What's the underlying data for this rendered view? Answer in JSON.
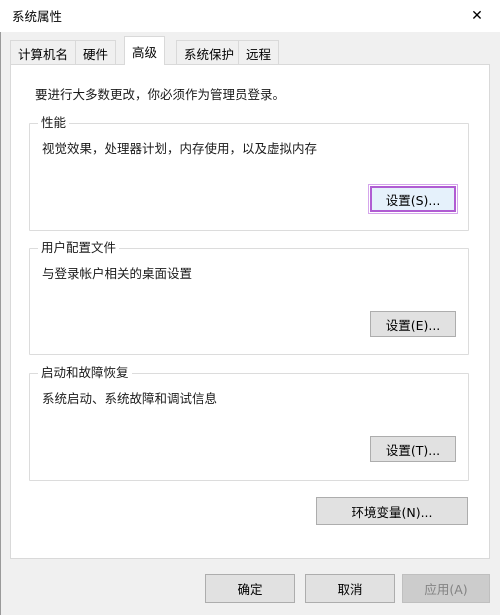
{
  "window": {
    "title": "系统属性",
    "close_glyph": "✕"
  },
  "tabs": [
    {
      "label": "计算机名"
    },
    {
      "label": "硬件"
    },
    {
      "label": "高级",
      "active": true
    },
    {
      "label": "系统保护"
    },
    {
      "label": "远程"
    }
  ],
  "panel": {
    "notice": "要进行大多数更改，你必须作为管理员登录。",
    "performance": {
      "title": "性能",
      "desc": "视觉效果，处理器计划，内存使用，以及虚拟内存",
      "button": "设置(S)..."
    },
    "profile": {
      "title": "用户配置文件",
      "desc": "与登录帐户相关的桌面设置",
      "button": "设置(E)..."
    },
    "startup": {
      "title": "启动和故障恢复",
      "desc": "系统启动、系统故障和调试信息",
      "button": "设置(T)..."
    },
    "env_button": "环境变量(N)..."
  },
  "footer": {
    "ok": "确定",
    "cancel": "取消",
    "apply": "应用(A)"
  },
  "colors": {
    "highlight_border": "#b05cd2",
    "face": "#f0f0f0",
    "button": "#e1e1e1"
  }
}
